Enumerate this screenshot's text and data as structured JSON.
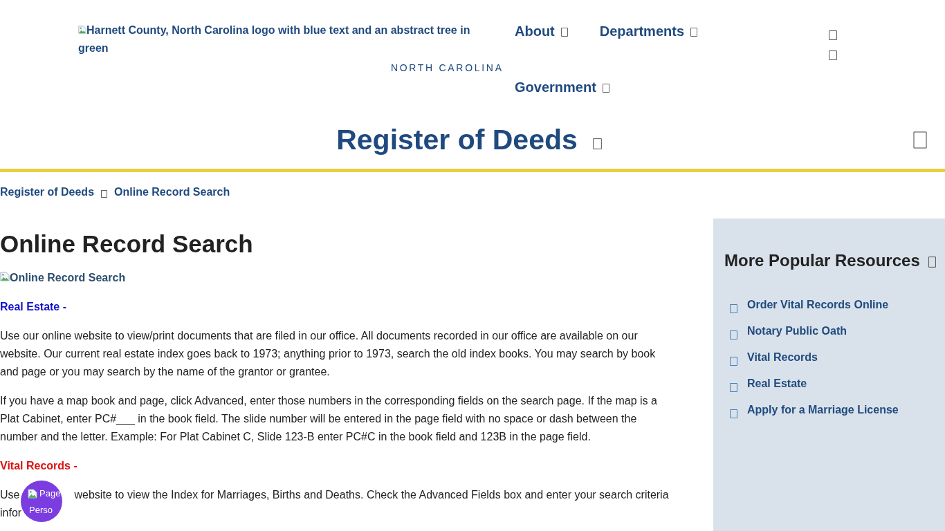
{
  "header": {
    "logo_alt": "Harnett County, North Carolina logo with blue text and an abstract tree in green",
    "tagline": "NORTH CAROLINA",
    "nav": [
      "About",
      "Departments",
      "Government"
    ]
  },
  "page_title": "Register of Deeds",
  "breadcrumb": [
    "Register of Deeds",
    "Online Record Search"
  ],
  "main": {
    "heading": "Online Record Search",
    "image_alt": "Online Record Search",
    "sections": [
      {
        "title": "Real Estate -",
        "color": "#1111cc",
        "paragraphs": [
          {
            "kind": "text",
            "text": "Use our online website to view/print documents that are filed in our office. All documents recorded in our office are available on our website. Our current real estate index goes back to 1973; anything prior to 1973, search the old index books. You may search by book and page or you may search by the name of the grantor or grantee."
          },
          {
            "kind": "text",
            "text": "If you have a map book and page, click Advanced, enter those numbers in the corresponding fields on the search page. If the map is a Plat Cabinet, enter PC#___ in the book field. The slide number will be entered in the page field with no space or dash between the number and the letter. Example: For Plat Cabinet C, Slide 123-B enter PC#C in the book field and 123B in the page field."
          }
        ]
      },
      {
        "title": "Vital Records -",
        "color": "#dd1111",
        "paragraphs": [
          {
            "kind": "covered",
            "parts": [
              "Use",
              "website to view the Index for Marriages, Births and Deaths. Check the Advanced Fields box and enter your search criteria",
              "infor"
            ]
          }
        ]
      }
    ]
  },
  "sidebar": {
    "title": "More Popular Resources",
    "links": [
      "Order Vital Records Online",
      "Notary Public Oath",
      "Vital Records",
      "Real Estate",
      "Apply for a Marriage License"
    ]
  },
  "floating_button": {
    "line_1": "Page",
    "line_2": "Perso"
  }
}
